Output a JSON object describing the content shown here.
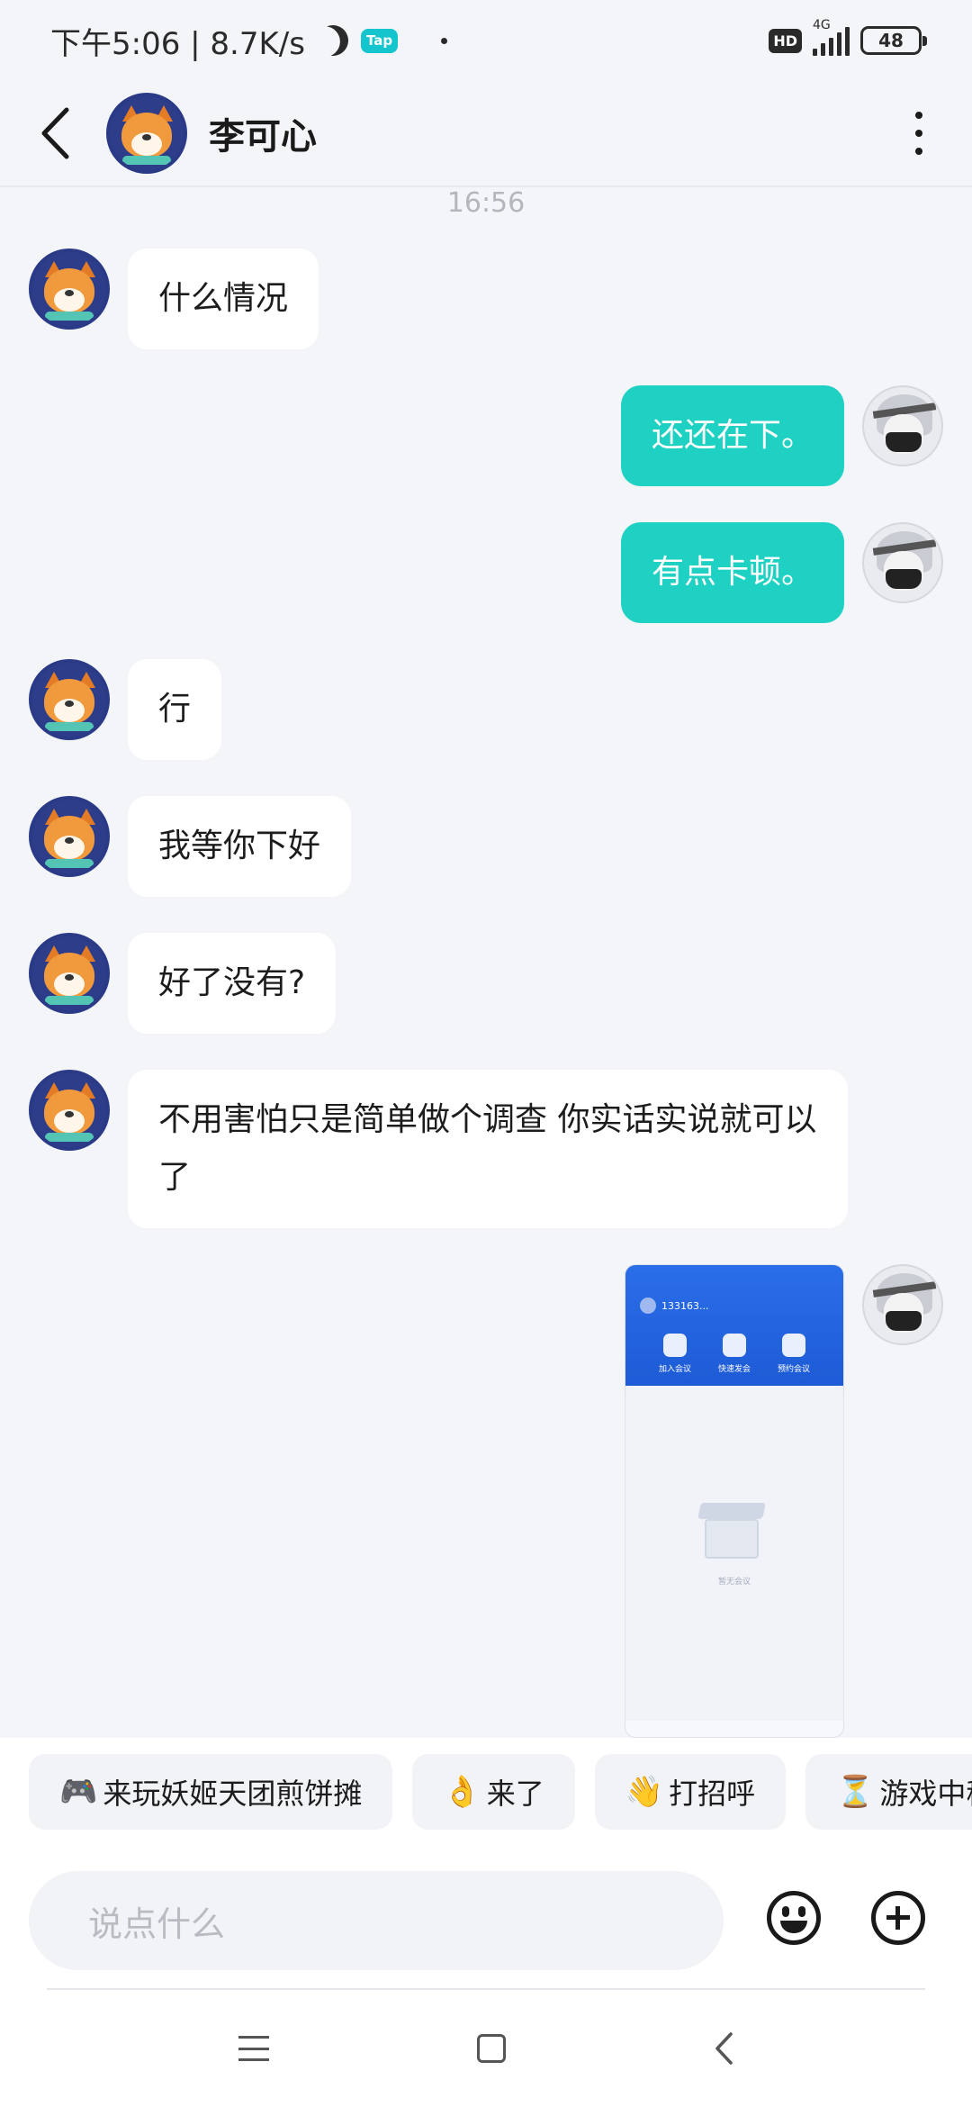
{
  "status_bar": {
    "time_speed": "下午5:06 | 8.7K/s",
    "tap_badge": "Tap",
    "hd": "HD",
    "network": "4G",
    "battery": "48"
  },
  "header": {
    "back_icon": "chevron-left-icon",
    "contact_name": "李可心",
    "more_icon": "more-vertical-icon"
  },
  "chat": {
    "timestamp": "16:56",
    "messages": [
      {
        "side": "in",
        "text": "什么情况"
      },
      {
        "side": "out",
        "text": "还还在下。"
      },
      {
        "side": "out",
        "text": "有点卡顿。"
      },
      {
        "side": "in",
        "text": "行"
      },
      {
        "side": "in",
        "text": "我等你下好"
      },
      {
        "side": "in",
        "text": "好了没有?"
      },
      {
        "side": "in",
        "text": "不用害怕只是简单做个调查 你实话实说就可以了"
      }
    ],
    "image_message": {
      "user_id": "133163...",
      "actions": [
        "加入会议",
        "快速发会",
        "预约会议"
      ],
      "empty_text": "暂无会议"
    }
  },
  "quick_replies": [
    {
      "emoji": "🎮",
      "label": "来玩妖姬天团煎饼摊"
    },
    {
      "emoji": "👌",
      "label": "来了"
    },
    {
      "emoji": "👋",
      "label": "打招呼"
    },
    {
      "emoji": "⏳",
      "label": "游戏中稍"
    }
  ],
  "input": {
    "placeholder": "说点什么"
  },
  "colors": {
    "accent": "#1ed1c2",
    "background": "#f4f5f8"
  }
}
